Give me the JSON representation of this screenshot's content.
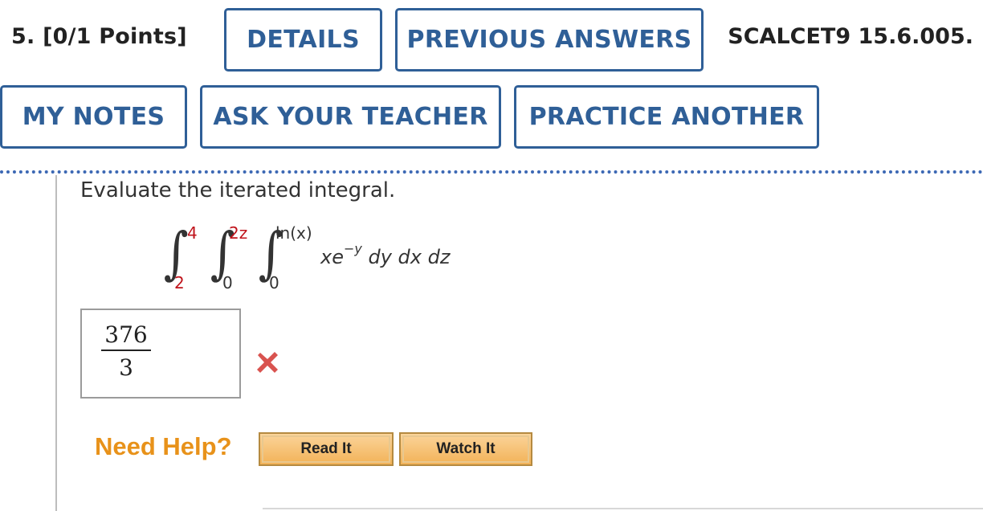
{
  "header": {
    "question_number": "5.",
    "points": "[0/1 Points]",
    "details_label": "DETAILS",
    "previous_answers_label": "PREVIOUS ANSWERS",
    "problem_code": "SCALCET9 15.6.005."
  },
  "actions": {
    "my_notes_label": "MY NOTES",
    "ask_teacher_label": "ASK YOUR TEACHER",
    "practice_another_label": "PRACTICE ANOTHER"
  },
  "question": {
    "prompt": "Evaluate the iterated integral.",
    "integral": {
      "outer_upper": "4",
      "outer_lower": "2",
      "middle_upper": "2z",
      "middle_lower": "0",
      "inner_upper": "ln(x)",
      "inner_lower": "0",
      "integrand_base": "xe",
      "integrand_exponent": "−y",
      "differentials": "dy dx dz"
    }
  },
  "answer": {
    "numerator": "376",
    "denominator": "3",
    "status": "incorrect",
    "status_icon": "x-mark-icon",
    "status_color": "#d9534f"
  },
  "help": {
    "label": "Need Help?",
    "read_it_label": "Read It",
    "watch_it_label": "Watch It"
  },
  "colors": {
    "button_blue": "#2f5f97",
    "help_orange": "#e8921a",
    "limit_red": "#c0131b"
  }
}
